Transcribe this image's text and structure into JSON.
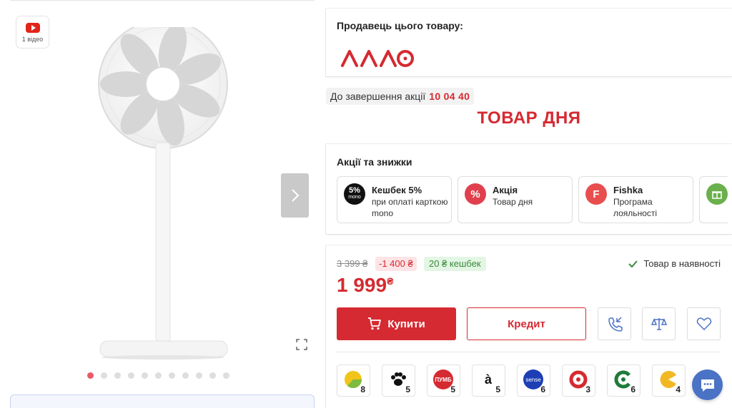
{
  "gallery": {
    "video_label": "1 відео",
    "dots_count": 11,
    "active_dot": 0
  },
  "seller": {
    "title": "Продавець цього товару:",
    "logo_text": "аллo"
  },
  "deal": {
    "timer_label": "До завершення акції",
    "timer_value": "10 04 40",
    "title": "ТОВАР ДНЯ"
  },
  "promos": {
    "title": "Акції та знижки",
    "items": [
      {
        "icon": "mono-cashback-icon",
        "badge": "5%",
        "badge_sub": "mono",
        "name": "Кешбек 5%",
        "desc": "при оплаті карткою mono",
        "color": "#111111"
      },
      {
        "icon": "percent-icon",
        "badge": "%",
        "badge_sub": "",
        "name": "Акція",
        "desc": "Товар дня",
        "color": "#e0404e"
      },
      {
        "icon": "fishka-icon",
        "badge": "F",
        "badge_sub": "",
        "name": "Fishka",
        "desc": "Програма лояльності",
        "color": "#e94e4e"
      },
      {
        "icon": "gift-icon",
        "badge": "",
        "badge_sub": "",
        "name": "",
        "desc": "",
        "color": "#6ab04c"
      }
    ]
  },
  "purchase": {
    "old_price": "3 399 ₴",
    "discount": "-1 400 ₴",
    "cashback": "20 ₴ кешбек",
    "stock": "Товар в наявності",
    "price": "1 999",
    "currency": "₴",
    "buy_label": "Купити",
    "credit_label": "Кредит"
  },
  "payment_methods": [
    {
      "icon": "pie-pay-icon",
      "count": "8",
      "color": "#f0c419"
    },
    {
      "icon": "paw-pay-icon",
      "count": "5",
      "color": "#111111"
    },
    {
      "icon": "puma-pay-icon",
      "label": "ПУМБ",
      "count": "5",
      "color": "#d52a31"
    },
    {
      "icon": "a-pay-icon",
      "label": "à",
      "count": "5",
      "color": "#ffffff"
    },
    {
      "icon": "sense-pay-icon",
      "label": "sense",
      "count": "6",
      "color": "#1e3fb4"
    },
    {
      "icon": "ring-pay-icon",
      "count": "3",
      "color": "#d52a31"
    },
    {
      "icon": "leaf-pay-icon",
      "count": "6",
      "color": "#1f7a3a"
    },
    {
      "icon": "pacman-pay-icon",
      "count": "4",
      "color": "#f2b824"
    }
  ],
  "colors": {
    "accent": "#d52a31",
    "stock_green": "#3a8a3d",
    "chat_blue": "#4a72c5"
  }
}
